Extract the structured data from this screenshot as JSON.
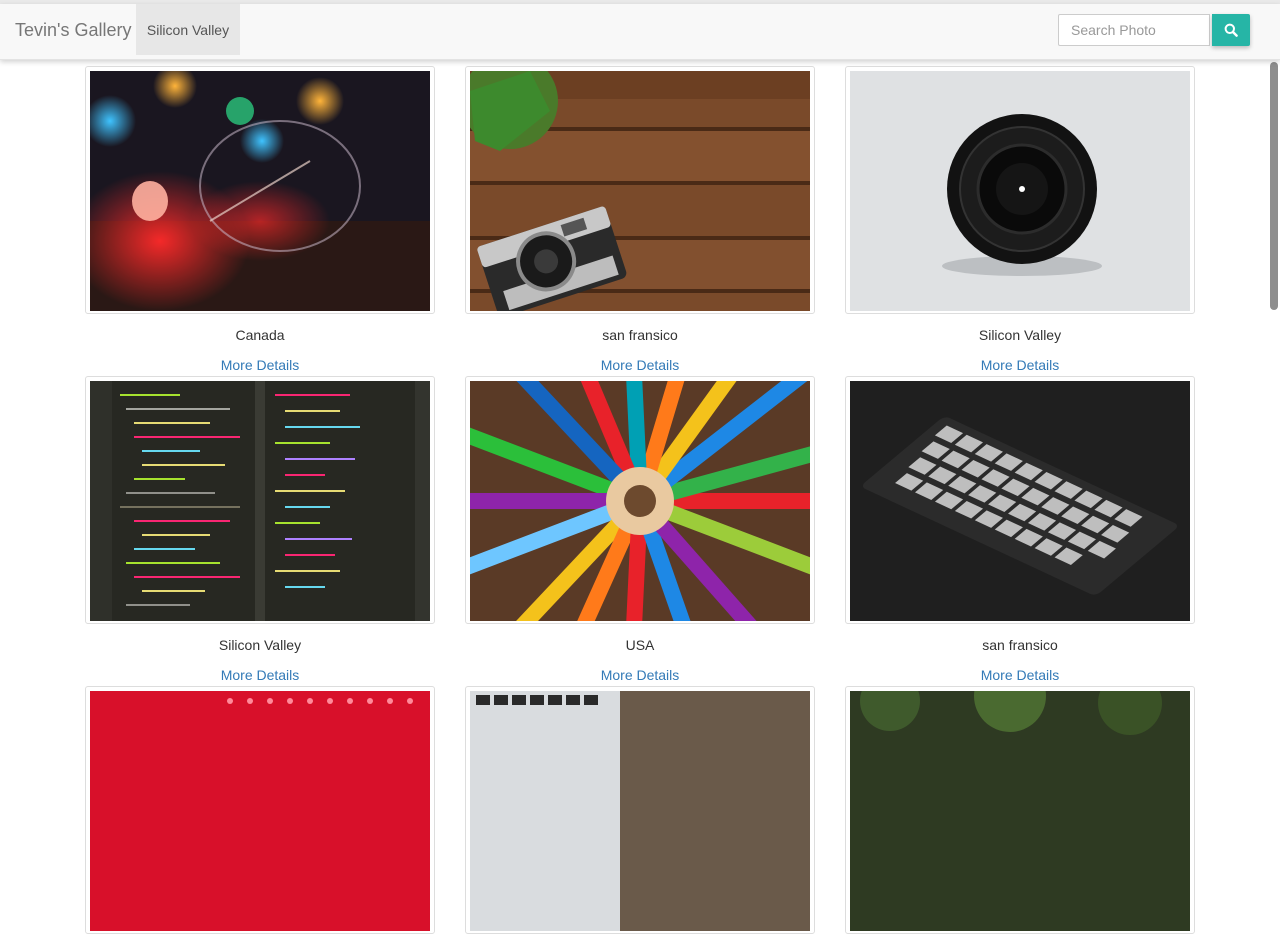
{
  "navbar": {
    "brand": "Tevin's Gallery",
    "active_item": "Silicon Valley",
    "search": {
      "placeholder": "Search Photo"
    },
    "accent_color": "#26b5a6"
  },
  "gallery": {
    "more_label": "More Details",
    "items": [
      {
        "caption": "Canada",
        "photo": "light-bulb-photo"
      },
      {
        "caption": "san fransico",
        "photo": "camera-on-wood-photo"
      },
      {
        "caption": "Silicon Valley",
        "photo": "camera-lens-photo"
      },
      {
        "caption": "Silicon Valley",
        "photo": "code-editor-photo"
      },
      {
        "caption": "USA",
        "photo": "colored-pencils-photo"
      },
      {
        "caption": "san fransico",
        "photo": "keyboard-photo"
      },
      {
        "caption": "",
        "photo": "red-lights-photo"
      },
      {
        "caption": "",
        "photo": "laptop-photo"
      },
      {
        "caption": "",
        "photo": "forest-photo"
      }
    ]
  }
}
